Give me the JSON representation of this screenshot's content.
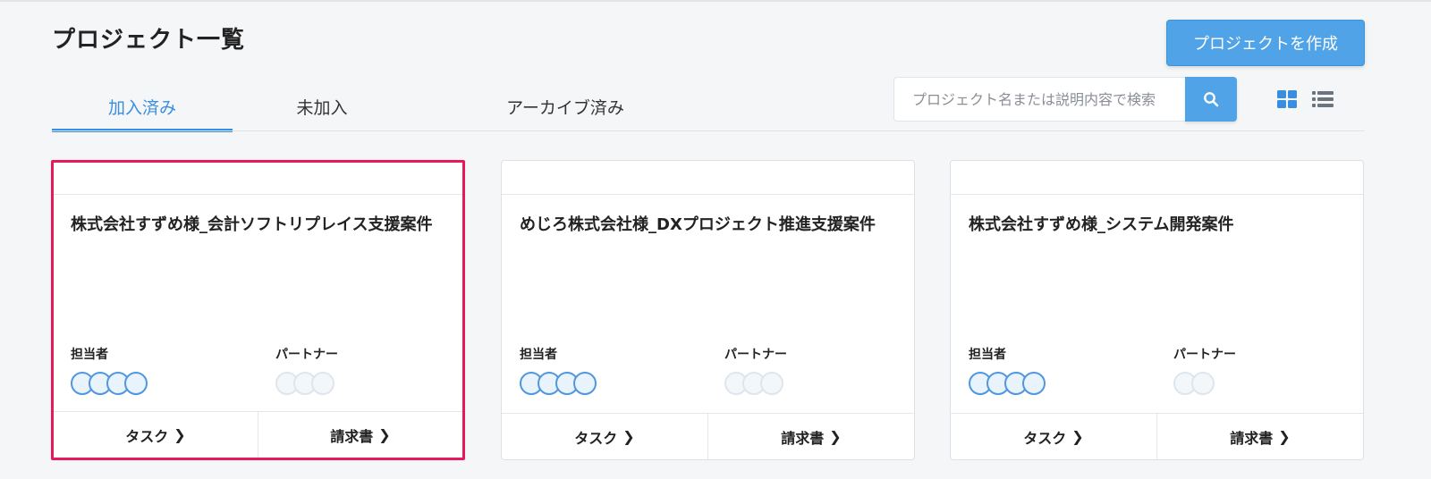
{
  "header": {
    "title": "プロジェクト一覧",
    "create_button": "プロジェクトを作成"
  },
  "tabs": [
    {
      "label": "加入済み",
      "active": true
    },
    {
      "label": "未加入",
      "active": false
    },
    {
      "label": "アーカイブ済み",
      "active": false
    }
  ],
  "search": {
    "placeholder": "プロジェクト名または説明内容で検索",
    "value": ""
  },
  "view_toggle": {
    "grid_icon": "grid-view-icon",
    "list_icon": "list-view-icon"
  },
  "labels": {
    "manager": "担当者",
    "partner": "パートナー",
    "task": "タスク",
    "invoice": "請求書"
  },
  "projects": [
    {
      "title": "株式会社すずめ様_会計ソフトリプレイス支援案件",
      "manager_count": 4,
      "partner_count": 3,
      "highlighted": true
    },
    {
      "title": "めじろ株式会社様_DXプロジェクト推進支援案件",
      "manager_count": 4,
      "partner_count": 3,
      "highlighted": false
    },
    {
      "title": "株式会社すずめ様_システム開発案件",
      "manager_count": 4,
      "partner_count": 2,
      "highlighted": false
    }
  ],
  "colors": {
    "accent": "#3a8ee0",
    "button": "#4fa3e6",
    "highlight": "#e8195a"
  }
}
